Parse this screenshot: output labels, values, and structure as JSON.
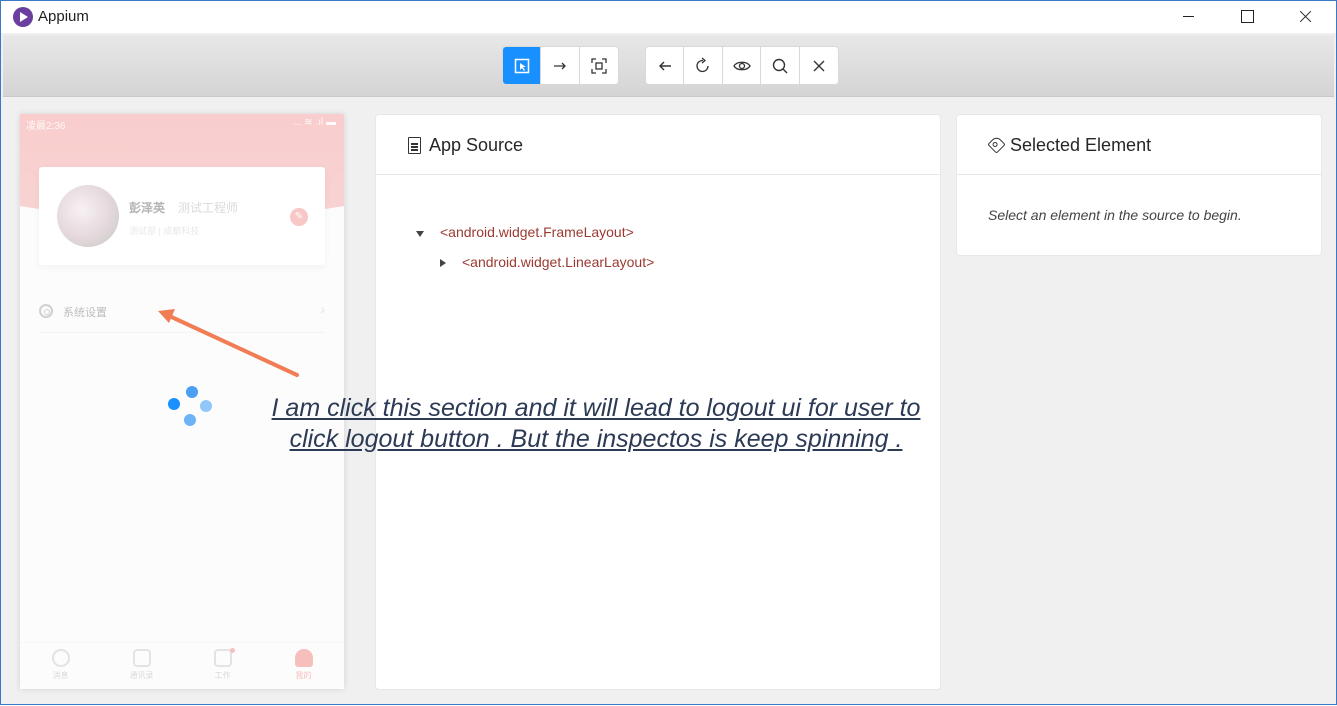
{
  "window": {
    "title": "Appium"
  },
  "toolbar": {
    "group1": [
      {
        "name": "select-elements",
        "icon": "select-cursor-icon"
      },
      {
        "name": "swipe",
        "icon": "arrow-right-icon"
      },
      {
        "name": "tap-coordinates",
        "icon": "frame-icon"
      }
    ],
    "group2": [
      {
        "name": "back",
        "icon": "arrow-left-icon"
      },
      {
        "name": "refresh",
        "icon": "reload-icon"
      },
      {
        "name": "recorder",
        "icon": "eye-icon"
      },
      {
        "name": "search",
        "icon": "search-icon"
      },
      {
        "name": "quit",
        "icon": "close-icon"
      }
    ],
    "accent_color": "#1890ff"
  },
  "device": {
    "status_time": "凌晨2:36",
    "status_icons": "... ≋ .ıl ▬",
    "profile": {
      "name": "彭泽英",
      "role": "测试工程师",
      "sub": "测试部 | 成都科技"
    },
    "settings_label": "系统设置",
    "tabs": [
      "消息",
      "通讯录",
      "工作",
      "我的"
    ]
  },
  "source_panel": {
    "title": "App Source",
    "tree": [
      {
        "label": "<android.widget.FrameLayout>",
        "expanded": true
      },
      {
        "label": "<android.widget.LinearLayout>",
        "expanded": false
      }
    ]
  },
  "selected_panel": {
    "title": "Selected Element",
    "message": "Select an element in the source to begin."
  },
  "annotation": {
    "line1": "I am click this section and it will lead to logout ui for user to ",
    "line2": "click logout button . But the inspectos is keep spinning . ",
    "color": "#2c3a55",
    "arrow_color": "#f07d54"
  }
}
